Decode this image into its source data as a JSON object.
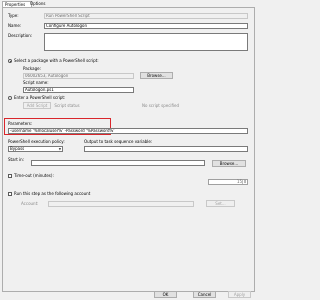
{
  "tabs": [
    "Properties",
    "Options"
  ],
  "type": {
    "label": "Type:",
    "value": "Run PowerShell Script"
  },
  "name": {
    "label": "Name:",
    "value": "Configure Autologon"
  },
  "description": {
    "label": "Description:",
    "value": ""
  },
  "package_section": {
    "radio_label": "Select a package with a PowerShell script:",
    "package_label": "Package:",
    "package_value": "06002653, Autologon",
    "browse_label": "Browse...",
    "script_name_label": "Script name:",
    "script_name_value": "Autologon.ps1"
  },
  "enter_script": {
    "radio_label": "Enter a PowerShell script:",
    "add_script_label": "Add Script",
    "script_status": "No script specified"
  },
  "parameters": {
    "label": "Parameters:",
    "value": "-username '%Vlocaluser%' -Password '%Password%'"
  },
  "execution_policy": {
    "label": "PowerShell execution policy:",
    "value": "Bypass"
  },
  "output_var": {
    "label": "Output to task sequence variable:",
    "value": ""
  },
  "start_in": {
    "label": "Start in:",
    "value": "",
    "browse_label": "Browse..."
  },
  "timeout": {
    "label": "Time-out (minutes):",
    "value": "15"
  },
  "run_as": {
    "label": "Run this step as the following account",
    "account_label": "Account:",
    "set_label": "Set..."
  },
  "footer": {
    "ok": "OK",
    "cancel": "Cancel",
    "apply": "Apply"
  }
}
